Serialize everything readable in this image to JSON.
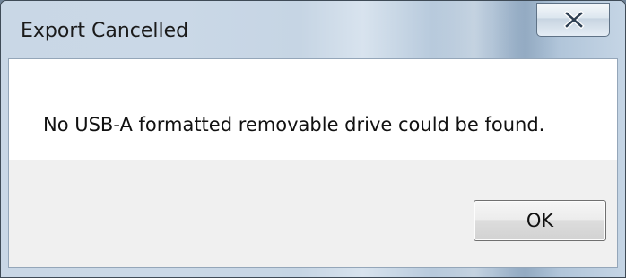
{
  "window": {
    "title": "Export Cancelled"
  },
  "title_buttons": {
    "close_icon": "close-icon"
  },
  "dialog": {
    "message": "No USB-A formatted removable drive could be found.",
    "ok_label": "OK"
  }
}
